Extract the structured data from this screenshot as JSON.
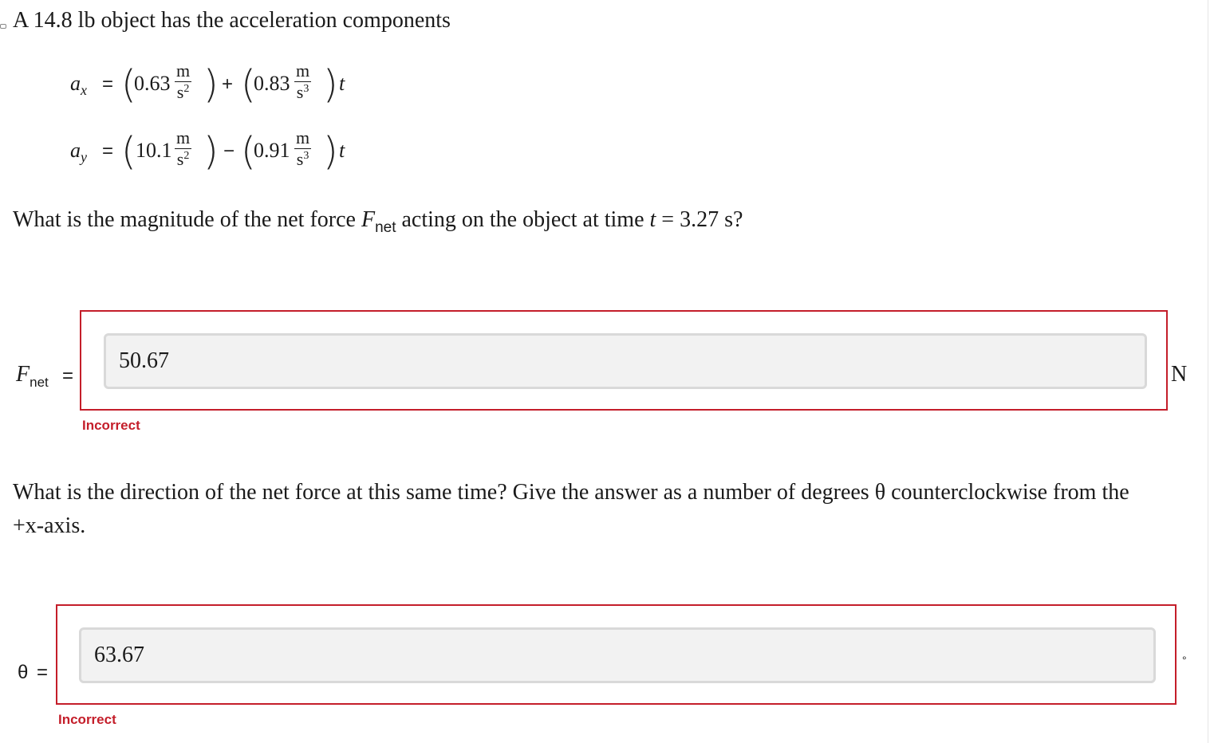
{
  "problem": {
    "intro": "A 14.8 lb object has the acceleration components",
    "eq_x": {
      "symbol": "a",
      "sub": "x",
      "const": "0.63",
      "sign": "+",
      "coef": "0.83",
      "var": "t",
      "unit_num": "m",
      "unit_den1": "s",
      "pow1": "2",
      "unit_den2": "s",
      "pow2": "3"
    },
    "eq_y": {
      "symbol": "a",
      "sub": "y",
      "const": "10.1",
      "sign": "−",
      "coef": "0.91",
      "var": "t",
      "unit_num": "m",
      "unit_den1": "s",
      "pow1": "2",
      "unit_den2": "s",
      "pow2": "3"
    },
    "q1": {
      "pre": "What is the magnitude of the net force ",
      "F": "F",
      "sub": "net",
      "mid": " acting on the object at time ",
      "t": "t",
      "post": " = 3.27 s?"
    },
    "q2": {
      "line1": "What is the direction of the net force at this same time? Give the answer as a number of degrees θ counterclockwise from the",
      "line2": "+x-axis."
    }
  },
  "answer1": {
    "label_F": "F",
    "label_sub": "net",
    "equals": "=",
    "value": "50.67",
    "unit": "N",
    "feedback": "Incorrect"
  },
  "answer2": {
    "label": "θ",
    "equals": "=",
    "value": "63.67",
    "unit": "°",
    "feedback": "Incorrect"
  },
  "colors": {
    "error": "#c41e2a",
    "input_bg": "#f2f2f2"
  }
}
